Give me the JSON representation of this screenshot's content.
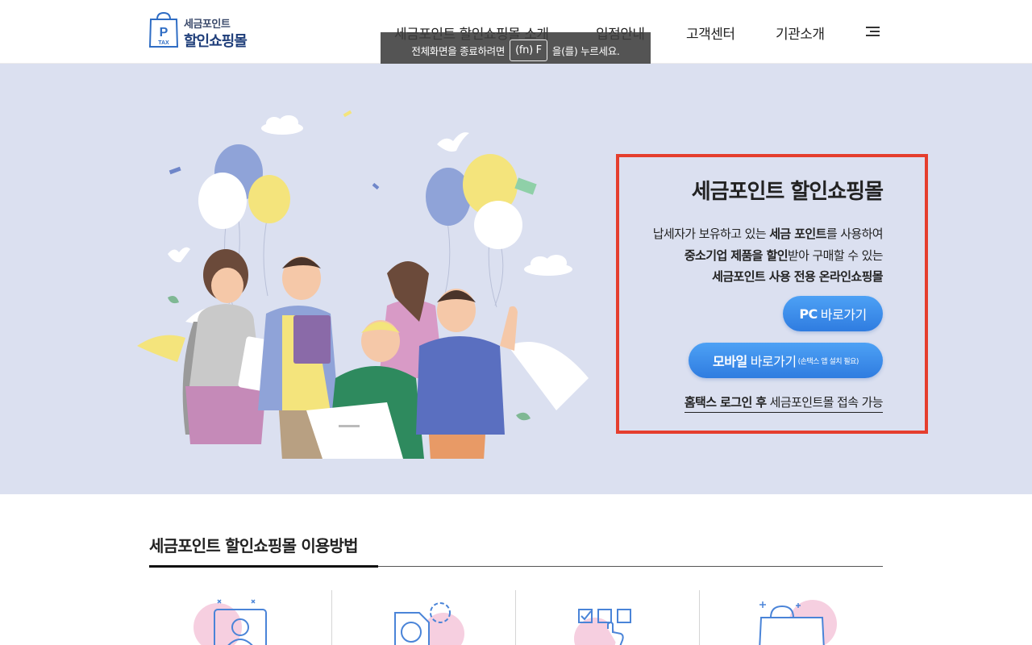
{
  "header": {
    "logo": {
      "line1": "세금포인트",
      "line2": "할인쇼핑몰",
      "badge_letter": "P",
      "badge_text": "TAX"
    },
    "nav": [
      {
        "label": "세금포인트 할인쇼핑몰 소개"
      },
      {
        "label": "입점안내"
      },
      {
        "label": "고객센터"
      },
      {
        "label": "기관소개"
      }
    ],
    "menu_icon": "hamburger-icon"
  },
  "toast": {
    "before": "전체화면을 종료하려면",
    "key": "(fn) F",
    "after": "을(를) 누르세요."
  },
  "hero": {
    "title": "세금포인트 할인쇼핑몰",
    "desc_line1_pre": "납세자가 보유하고 있는 ",
    "desc_line1_bold": "세금 포인트",
    "desc_line1_post": "를 사용하여",
    "desc_line2_bold": "중소기업 제품을 할인",
    "desc_line2_post": "받아 구매할 수 있는",
    "desc_line3_bold": "세금포인트 사용 전용 온라인쇼핑몰",
    "pc_button": {
      "strong": "PC",
      "label": "바로가기"
    },
    "mobile_button": {
      "strong": "모바일",
      "label": "바로가기",
      "small": "(손택스 앱 설치 필요)"
    },
    "login_note_bold": "홈택스 로그인 후",
    "login_note_text": " 세금포인트몰 접속 가능",
    "highlight_color": "#e53e2e",
    "background_color": "#dbe0f0"
  },
  "usage": {
    "title": "세금포인트 할인쇼핑몰 이용방법",
    "steps": [
      {
        "icon": "user-screen-icon"
      },
      {
        "icon": "document-gear-icon"
      },
      {
        "icon": "checklist-click-icon"
      },
      {
        "icon": "shopping-bag-icon"
      }
    ]
  }
}
